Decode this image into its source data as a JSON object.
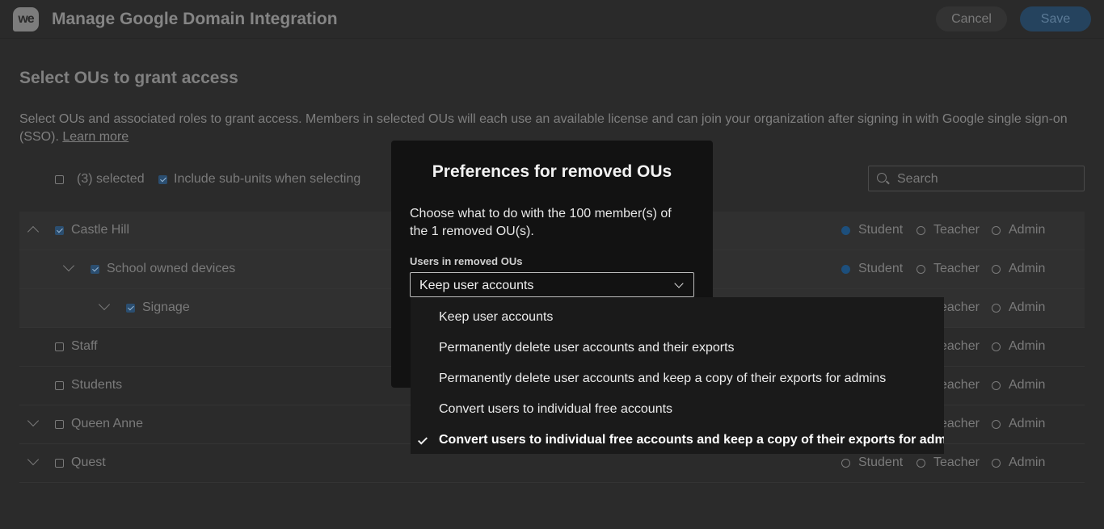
{
  "header": {
    "logo_text": "we",
    "title": "Manage Google Domain Integration",
    "cancel_label": "Cancel",
    "save_label": "Save"
  },
  "section": {
    "title": "Select OUs to grant access",
    "description": "Select OUs and associated roles to grant access. Members in selected OUs will each use an available license and can join your organization after signing in with Google single sign-on (SSO).",
    "learn_more": "Learn more"
  },
  "selection": {
    "count_label": "(3) selected",
    "include_subunits_label": "Include sub-units when selecting",
    "include_subunits_checked": true
  },
  "search": {
    "placeholder": "Search"
  },
  "roles": [
    "Student",
    "Teacher",
    "Admin"
  ],
  "ous": [
    {
      "name": "Castle Hill",
      "level": 0,
      "expanded": true,
      "checked": true,
      "role": "Student"
    },
    {
      "name": "School owned devices",
      "level": 1,
      "expanded": false,
      "checked": true,
      "role": "Student"
    },
    {
      "name": "Signage",
      "level": 2,
      "expanded": false,
      "checked": true,
      "role": ""
    },
    {
      "name": "Staff",
      "level": 0,
      "expanded": null,
      "checked": false,
      "role": ""
    },
    {
      "name": "Students",
      "level": 0,
      "expanded": null,
      "checked": false,
      "role": ""
    },
    {
      "name": "Queen Anne",
      "level": 0,
      "expanded": false,
      "checked": false,
      "role": ""
    },
    {
      "name": "Quest",
      "level": 0,
      "expanded": false,
      "checked": false,
      "role": ""
    }
  ],
  "modal": {
    "title": "Preferences for removed OUs",
    "text": "Choose what to do with the 100 member(s) of the 1 removed OU(s).",
    "field_label": "Users in removed OUs",
    "selected_value": "Keep user accounts",
    "options": [
      {
        "label": "Keep user accounts",
        "checked": false
      },
      {
        "label": "Permanently delete user accounts and their exports",
        "checked": false
      },
      {
        "label": "Permanently delete user accounts and keep a copy of their exports for admins",
        "checked": false
      },
      {
        "label": "Convert users to individual free accounts",
        "checked": false
      },
      {
        "label": "Convert users to individual free accounts and keep a copy of their exports for admins",
        "checked": true
      }
    ]
  },
  "colors": {
    "background": "#2b2b2b",
    "modal": "#121212",
    "menu": "#1a1a1a",
    "accent": "#25435e"
  }
}
